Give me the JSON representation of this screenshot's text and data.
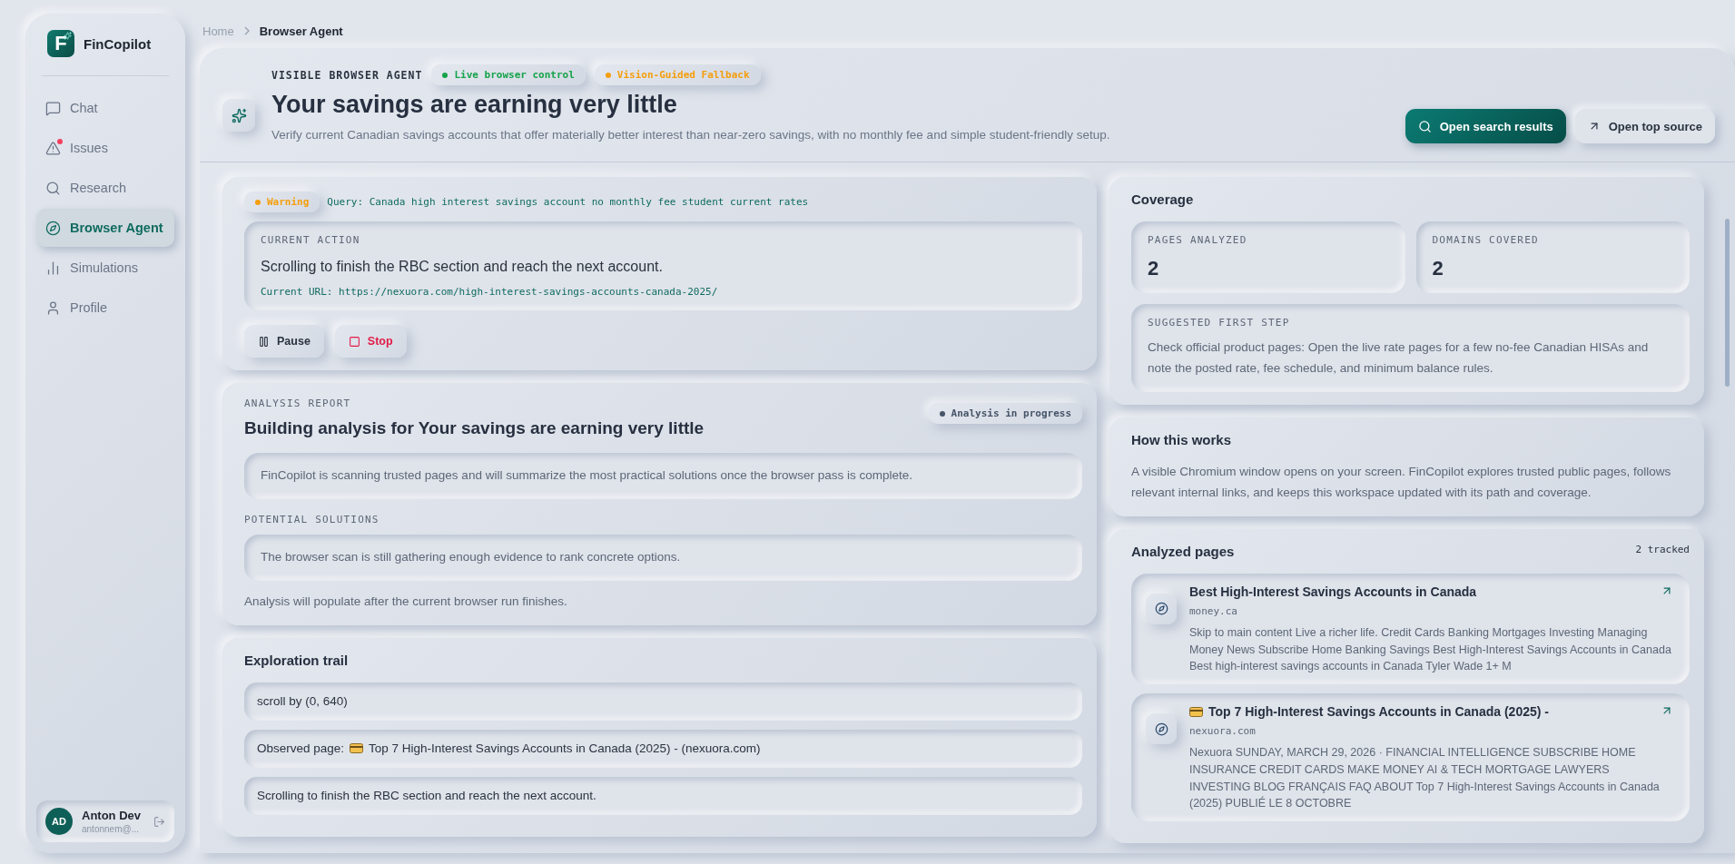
{
  "app": {
    "logo_letter": "F",
    "name": "FinCopilot"
  },
  "nav": [
    {
      "label": "Chat",
      "selected": false,
      "alert": false
    },
    {
      "label": "Issues",
      "selected": false,
      "alert": true
    },
    {
      "label": "Research",
      "selected": false,
      "alert": false
    },
    {
      "label": "Browser Agent",
      "selected": true,
      "alert": false
    },
    {
      "label": "Simulations",
      "selected": false,
      "alert": false
    },
    {
      "label": "Profile",
      "selected": false,
      "alert": false
    }
  ],
  "user": {
    "initials": "AD",
    "name": "Anton Dev",
    "email": "antonnem@..."
  },
  "breadcrumb": [
    "Home",
    "Browser Agent"
  ],
  "header": {
    "eyebrow": "VISIBLE BROWSER AGENT",
    "pills": [
      {
        "label": "Live browser control",
        "color": "#16a34a"
      },
      {
        "label": "Vision-Guided Fallback",
        "color": "#f59e0b"
      }
    ],
    "title": "Your savings are earning very little",
    "subtitle": "Verify current Canadian savings accounts that offer materially better interest than near-zero savings, with no monthly fee and simple student-friendly setup.",
    "buttons": [
      {
        "label": "Open search results",
        "kind": "primary"
      },
      {
        "label": "Open top source",
        "kind": "secondary"
      }
    ]
  },
  "run": {
    "status": {
      "label": "Warning",
      "color": "#f59e0b"
    },
    "query": "Query: Canada high interest savings account no monthly fee student current rates",
    "current_action": {
      "label": "CURRENT ACTION",
      "text": "Scrolling to finish the RBC section and reach the next account.",
      "url": "Current URL: https://nexuora.com/high-interest-savings-accounts-canada-2025/"
    },
    "controls": [
      {
        "label": "Pause",
        "kind": "pause"
      },
      {
        "label": "Stop",
        "kind": "stop"
      }
    ]
  },
  "report": {
    "eyebrow": "ANALYSIS REPORT",
    "title": "Building analysis for Your savings are earning very little",
    "status": {
      "label": "Analysis in progress",
      "color": "#475569"
    },
    "summary": "FinCopilot is scanning trusted pages and will summarize the most practical solutions once the browser pass is complete.",
    "solutions_label": "POTENTIAL SOLUTIONS",
    "solutions_text": "The browser scan is still gathering enough evidence to rank concrete options.",
    "footer": "Analysis will populate after the current browser run finishes."
  },
  "trail": {
    "title": "Exploration trail",
    "items": [
      {
        "text": "scroll by (0, 640)"
      },
      {
        "kind": "observed",
        "prefix": "Observed page:",
        "text": "Top 7 High-Interest Savings Accounts in Canada (2025) - (nexuora.com)"
      },
      {
        "text": "Scrolling to finish the RBC section and reach the next account."
      }
    ]
  },
  "coverage": {
    "title": "Coverage",
    "stats": [
      {
        "label": "PAGES ANALYZED",
        "value": "2"
      },
      {
        "label": "DOMAINS COVERED",
        "value": "2"
      }
    ],
    "step_label": "SUGGESTED FIRST STEP",
    "step_text": "Check official product pages: Open the live rate pages for a few no-fee Canadian HISAs and note the posted rate, fee schedule, and minimum balance rules."
  },
  "how": {
    "title": "How this works",
    "text": "A visible Chromium window opens on your screen. FinCopilot explores trusted public pages, follows relevant internal links, and keeps this workspace updated with its path and coverage."
  },
  "pages": {
    "title": "Analyzed pages",
    "count": "2 tracked",
    "items": [
      {
        "title": "Best High-Interest Savings Accounts in Canada",
        "domain": "money.ca",
        "excerpt": "Skip to main content Live a richer life. Credit Cards Banking Mortgages Investing Managing Money News Subscribe Home Banking Savings Best High-Interest Savings Accounts in Canada Best high-interest savings accounts in Canada Tyler Wade 1+ M"
      },
      {
        "kind": "card",
        "title": "Top 7 High-Interest Savings Accounts in Canada (2025) -",
        "domain": "nexuora.com",
        "excerpt": "Nexuora SUNDAY, MARCH 29, 2026 · FINANCIAL INTELLIGENCE SUBSCRIBE HOME INSURANCE CREDIT CARDS MAKE MONEY AI & TECH MORTGAGE LAWYERS INVESTING BLOG FRANÇAIS FAQ ABOUT Top 7 High-Interest Savings Accounts in Canada (2025) PUBLIÉ LE 8 OCTOBRE"
      }
    ]
  }
}
